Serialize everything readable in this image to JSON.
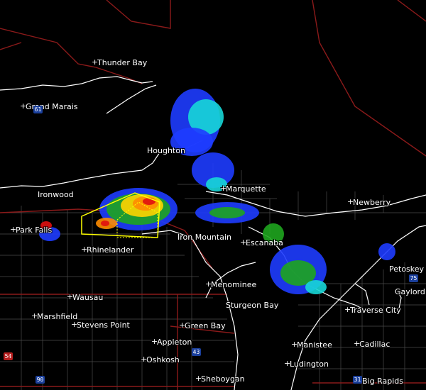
{
  "colors": {
    "background": "#000000",
    "border": "#8b1a1a",
    "coastline": "#ffffff",
    "county": "#4a4a4a",
    "warning_box": "#ffff00",
    "radar_light": "#1e3cff",
    "radar_mid": "#17d7d7",
    "radar_green": "#1ea51e",
    "radar_yellow": "#ffd400",
    "radar_orange": "#ff8c00",
    "radar_red": "#e01010"
  },
  "cities": [
    {
      "name": "Thunder Bay"
    },
    {
      "name": "Grand Marais"
    },
    {
      "name": "Houghton"
    },
    {
      "name": "Ironwood"
    },
    {
      "name": "Marquette"
    },
    {
      "name": "Newberry"
    },
    {
      "name": "Park Falls"
    },
    {
      "name": "Rhinelander"
    },
    {
      "name": "Iron Mountain"
    },
    {
      "name": "Escanaba"
    },
    {
      "name": "Petoskey"
    },
    {
      "name": "Menominee"
    },
    {
      "name": "Gaylord"
    },
    {
      "name": "Wausau"
    },
    {
      "name": "Sturgeon Bay"
    },
    {
      "name": "Traverse City"
    },
    {
      "name": "Marshfield"
    },
    {
      "name": "Stevens Point"
    },
    {
      "name": "Green Bay"
    },
    {
      "name": "Appleton"
    },
    {
      "name": "Manistee"
    },
    {
      "name": "Cadillac"
    },
    {
      "name": "Oshkosh"
    },
    {
      "name": "Ludington"
    },
    {
      "name": "Sheboygan"
    },
    {
      "name": "Big Rapids"
    }
  ],
  "shields": [
    {
      "label": "61",
      "color": "#1a3f9c"
    },
    {
      "label": "75",
      "color": "#1a3f9c"
    },
    {
      "label": "43",
      "color": "#1a3f9c"
    },
    {
      "label": "54",
      "color": "#b51d1d"
    },
    {
      "label": "90",
      "color": "#1a3f9c"
    },
    {
      "label": "31",
      "color": "#1a3f9c"
    }
  ]
}
